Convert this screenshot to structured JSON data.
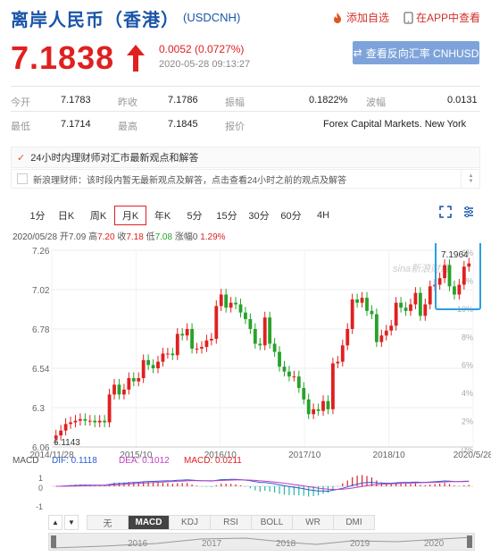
{
  "header": {
    "title": "离岸人民币（香港）",
    "code": "(USDCNH)",
    "add_watch": "添加自选",
    "app_view": "在APP中查看"
  },
  "quote": {
    "price": "7.1838",
    "change": "0.0052 (0.0727%)",
    "time": "2020-05-28 09:13:27",
    "reverse_label": "查看反向汇率 CNHUSD"
  },
  "stats": {
    "row1": [
      {
        "l": "今开",
        "v": "7.1783"
      },
      {
        "l": "昨收",
        "v": "7.1786"
      },
      {
        "l": "振幅",
        "v": "0.1822%"
      },
      {
        "l": "波幅",
        "v": "0.0131"
      }
    ],
    "row2": [
      {
        "l": "最低",
        "v": "7.1714"
      },
      {
        "l": "最高",
        "v": "7.1845"
      },
      {
        "l": "报价",
        "v": "Forex Capital Markets. New York"
      }
    ]
  },
  "banner": "24小时内理财师对汇市最新观点和解答",
  "note": "新浪理财师：该时段内暂无最新观点及解答，点击查看24小时之前的观点及解答",
  "tabs": [
    "1分",
    "日K",
    "周K",
    "月K",
    "年K",
    "5分",
    "15分",
    "30分",
    "60分",
    "4H"
  ],
  "active_tab": 3,
  "ohlc": {
    "date": "2020/05/28",
    "open_l": "开",
    "open": "7.09",
    "high_l": "高",
    "high": "7.20",
    "close_l": "收",
    "close": "7.18",
    "low_l": "低",
    "low": "7.08",
    "chg_l": "涨幅",
    "chg": "0",
    "pct": "1.29%"
  },
  "chart_data": {
    "type": "candlestick",
    "y_ticks": [
      "7.26",
      "7.02",
      "6.78",
      "6.54",
      "6.3",
      "6.06"
    ],
    "y_range": [
      6.06,
      7.26
    ],
    "pct_ticks": [
      "6%",
      "4%",
      "10%",
      "8%",
      "6%",
      "4%",
      "2%",
      "0%"
    ],
    "x_ticks": [
      "2014/11/28",
      "2015/10",
      "2016/10",
      "2017/10",
      "2018/10",
      "2020/5/28"
    ],
    "min_label": "6.1143",
    "max_label": "7.1964",
    "watermark": "sina新浪财经",
    "closes": [
      6.13,
      6.16,
      6.2,
      6.21,
      6.22,
      6.23,
      6.22,
      6.22,
      6.21,
      6.22,
      6.21,
      6.38,
      6.44,
      6.38,
      6.41,
      6.48,
      6.46,
      6.48,
      6.59,
      6.56,
      6.54,
      6.58,
      6.63,
      6.63,
      6.62,
      6.75,
      6.74,
      6.78,
      6.66,
      6.66,
      6.67,
      6.71,
      6.72,
      6.92,
      6.99,
      6.91,
      6.94,
      6.93,
      6.88,
      6.84,
      6.78,
      6.69,
      6.68,
      6.85,
      6.69,
      6.64,
      6.55,
      6.52,
      6.49,
      6.49,
      6.42,
      6.35,
      6.26,
      6.29,
      6.28,
      6.34,
      6.29,
      6.57,
      6.58,
      6.68,
      6.78,
      6.96,
      6.94,
      6.97,
      6.89,
      6.87,
      6.7,
      6.74,
      6.77,
      6.8,
      6.94,
      6.91,
      6.89,
      6.93,
      7.0,
      6.86,
      6.93,
      7.04,
      7.05,
      7.09,
      7.17,
      7.04,
      6.99,
      7.05,
      7.16,
      7.18
    ],
    "macd_ticks": [
      "1",
      "0",
      "-1"
    ],
    "years": [
      "2016",
      "2017",
      "2018",
      "2019",
      "2020"
    ]
  },
  "macd": {
    "name": "MACD",
    "dif": "DIF: 0.1118",
    "dea": "DEA: 0.1012",
    "macd": "MACD: 0.0211"
  },
  "indicators": [
    "无",
    "MACD",
    "KDJ",
    "RSI",
    "BOLL",
    "WR",
    "DMI"
  ],
  "active_indicator": 1,
  "nav": {
    "up": "▲",
    "down": "▼"
  }
}
